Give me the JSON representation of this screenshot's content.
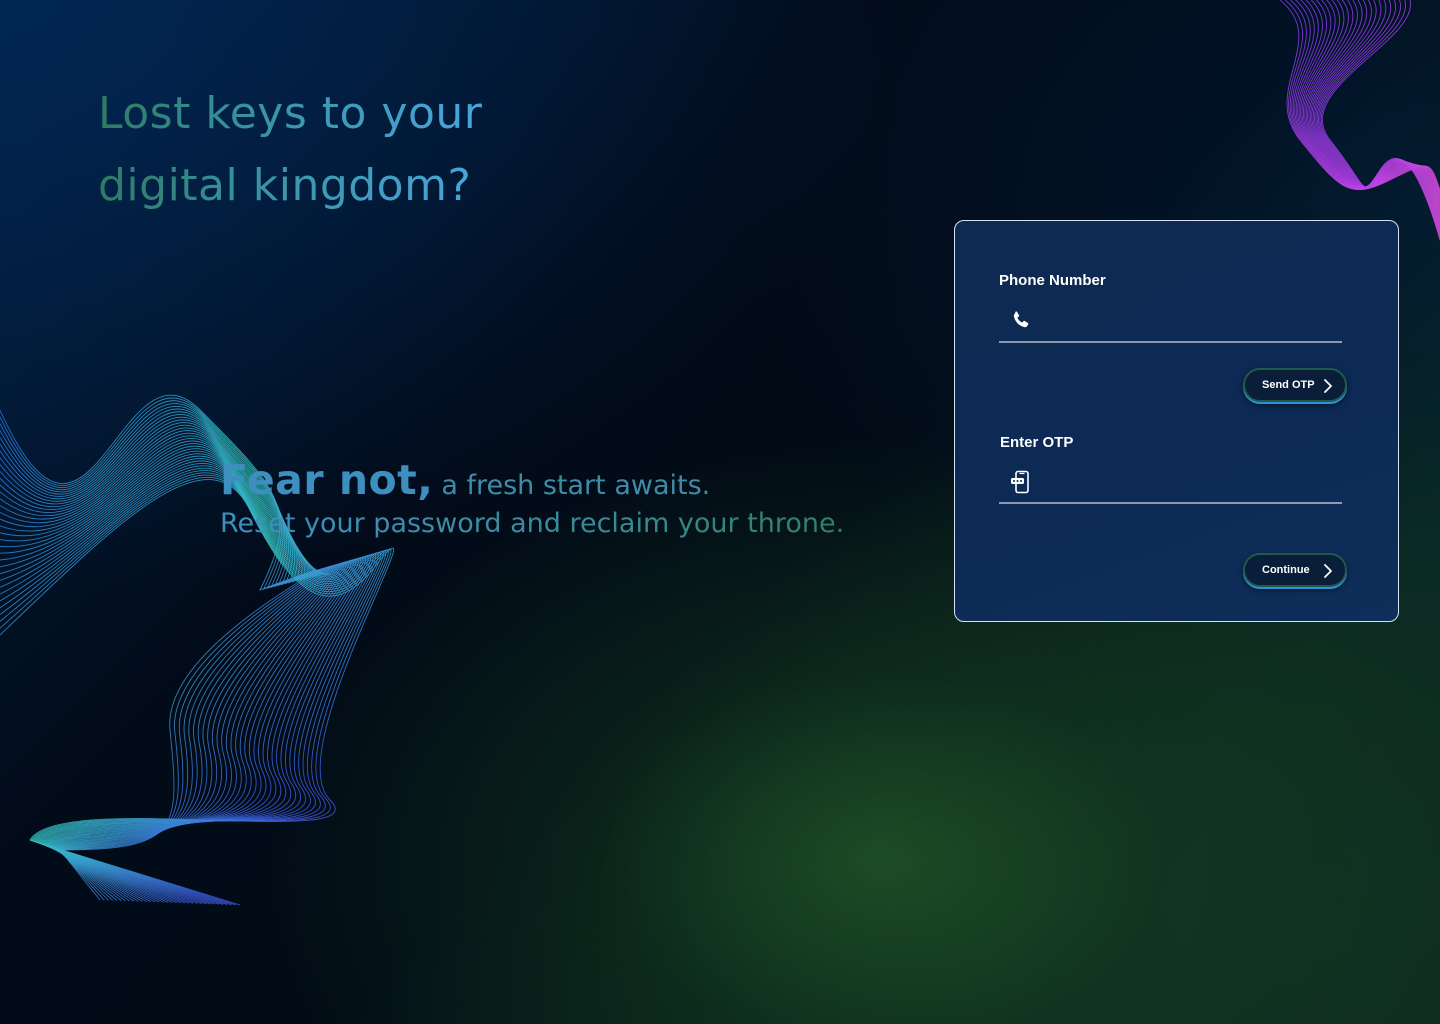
{
  "hero": {
    "headline_line1": "Lost keys to your",
    "headline_line2": "digital kingdom?",
    "tagline_emphasis": "Fear not,",
    "tagline_rest": "a fresh start awaits.",
    "tagline_line2": "Reset your password and reclaim your throne."
  },
  "form": {
    "phone": {
      "label": "Phone Number",
      "value": "",
      "placeholder": "",
      "icon": "phone-icon"
    },
    "send_otp_label": "Send OTP",
    "otp": {
      "label": "Enter OTP",
      "value": "",
      "placeholder": "",
      "icon": "otp-device-icon"
    },
    "continue_label": "Continue"
  },
  "colors": {
    "accent_blue": "#2e8fd6",
    "accent_green": "#1f5a4a",
    "card_bg": "#0c2a55",
    "card_border": "#d6e3f2"
  }
}
